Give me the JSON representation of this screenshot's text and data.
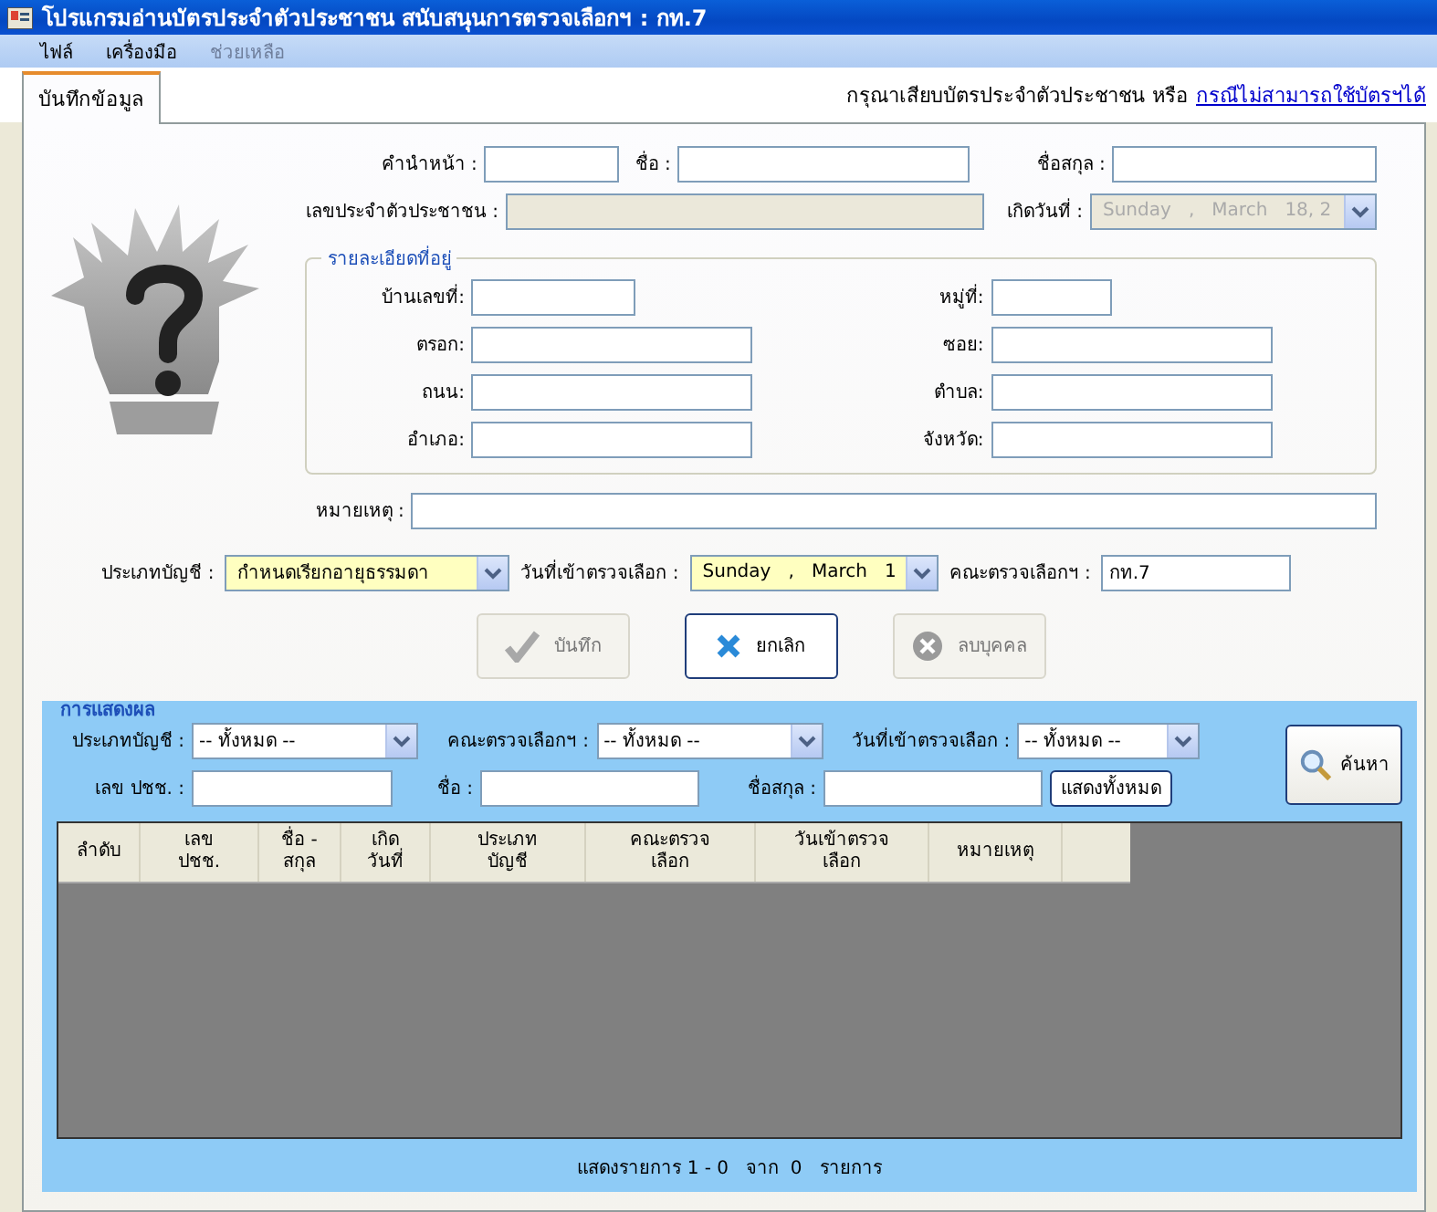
{
  "window": {
    "title": "โปรแกรมอ่านบัตรประจำตัวประชาชน สนับสนุนการตรวจเลือกฯ : กท.7"
  },
  "menu": [
    {
      "label": "ไฟล์",
      "disabled": false
    },
    {
      "label": "เครื่องมือ",
      "disabled": false
    },
    {
      "label": "ช่วยเหลือ",
      "disabled": true
    }
  ],
  "tabs": [
    {
      "label": "บันทึกข้อมูล",
      "selected": true
    }
  ],
  "notice": {
    "text": "กรุณาเสียบบัตรประจำตัวประชาชน หรือ",
    "link": "กรณีไม่สามารถใช้บัตรฯได้"
  },
  "person": {
    "title_label": "คำนำหน้า :",
    "name_label": "ชื่อ :",
    "surname_label": "ชื่อสกุล :",
    "id_label": "เลขประจำตัวประชาชน :",
    "birth_label": "เกิดวันที่ :",
    "birth_date": "Sunday   ,   March   18, 2",
    "birth_disabled": true
  },
  "address": {
    "title": "รายละเอียดที่อยู่",
    "fields": [
      {
        "label": "บ้านเลขที่:"
      },
      {
        "label": "หมู่ที่:"
      },
      {
        "label": "ตรอก:"
      },
      {
        "label": "ซอย:"
      },
      {
        "label": "ถนน:"
      },
      {
        "label": "ตำบล:"
      },
      {
        "label": "อำเภอ:"
      },
      {
        "label": "จังหวัด:"
      }
    ]
  },
  "remark_label": "หมายเหตุ :",
  "entry": {
    "type_label": "ประเภทบัญชี :",
    "type_value": "กำหนดเรียกอายุธรรมดา",
    "date_label": "วันที่เข้าตรวจเลือก :",
    "date_value": "Sunday   ,   March   1",
    "committee_label": "คณะตรวจเลือกฯ :",
    "committee_value": "กท.7"
  },
  "actions": [
    {
      "label": "บันทึก",
      "kind": "check",
      "disabled": true
    },
    {
      "label": "ยกเลิก",
      "kind": "cross",
      "disabled": false
    },
    {
      "label": "ลบบุคคล",
      "kind": "remove",
      "disabled": true
    }
  ],
  "results": {
    "title": "การแสดงผล",
    "filters": [
      {
        "label": "ประเภทบัญชี :",
        "value": "-- ทั้งหมด --"
      },
      {
        "label": "คณะตรวจเลือกฯ :",
        "value": "-- ทั้งหมด --"
      },
      {
        "label": "วันที่เข้าตรวจเลือก :",
        "value": "-- ทั้งหมด --"
      }
    ],
    "search_fields": [
      {
        "label": "เลข ปชช. :"
      },
      {
        "label": "ชื่อ :"
      },
      {
        "label": "ชื่อสกุล :"
      }
    ],
    "show_all": "แสดงทั้งหมด",
    "search": "ค้นหา",
    "columns": [
      "ลำดับ",
      "เลข\nปชช.",
      "ชื่อ -\nสกุล",
      "เกิด\nวันที่",
      "ประเภท\nบัญชี",
      "คณะตรวจ\nเลือก",
      "วันเข้าตรวจ\nเลือก",
      "หมายเหตุ"
    ],
    "status": "แสดงรายการ 1 - 0   จาก  0   รายการ"
  }
}
